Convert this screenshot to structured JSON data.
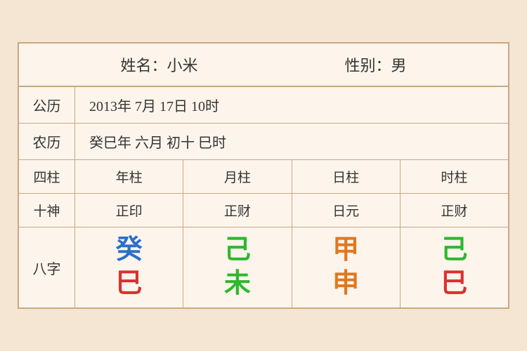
{
  "header": {
    "name_label": "姓名：小米",
    "gender_label": "性别：男"
  },
  "gregorian": {
    "label": "公历",
    "value": "2013年 7月 17日 10时"
  },
  "lunar": {
    "label": "农历",
    "value": "癸巳年 六月 初十 巳时"
  },
  "sijhu_row": {
    "label": "四柱",
    "cols": [
      "年柱",
      "月柱",
      "日柱",
      "时柱"
    ]
  },
  "shishen_row": {
    "label": "十神",
    "cols": [
      "正印",
      "正财",
      "日元",
      "正财"
    ]
  },
  "bazi_row": {
    "label": "八字",
    "cols": [
      {
        "top": "癸",
        "bottom": "巳",
        "top_color": "blue",
        "bottom_color": "red"
      },
      {
        "top": "己",
        "bottom": "未",
        "top_color": "green",
        "bottom_color": "green"
      },
      {
        "top": "甲",
        "bottom": "申",
        "top_color": "orange",
        "bottom_color": "orange"
      },
      {
        "top": "己",
        "bottom": "巳",
        "top_color": "green2",
        "bottom_color": "red"
      }
    ]
  }
}
